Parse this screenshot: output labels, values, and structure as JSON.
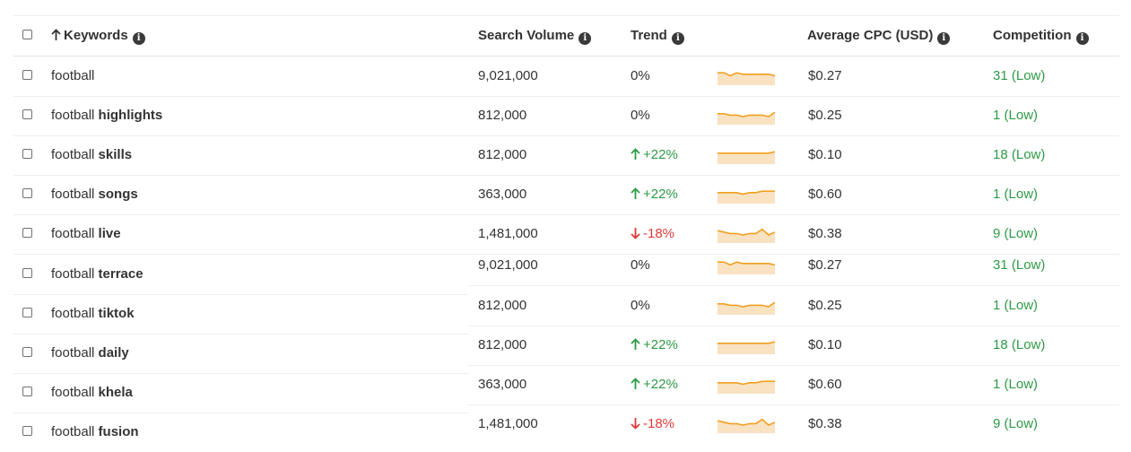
{
  "header": {
    "keywords": "Keywords",
    "search_volume": "Search Volume",
    "trend": "Trend",
    "cpc": "Average CPC (USD)",
    "competition": "Competition",
    "info_glyph": "i"
  },
  "rows_left": [
    {
      "prefix": "football",
      "bold": ""
    },
    {
      "prefix": "football",
      "bold": "highlights"
    },
    {
      "prefix": "football",
      "bold": "skills"
    },
    {
      "prefix": "football",
      "bold": "songs"
    },
    {
      "prefix": "football",
      "bold": "live"
    },
    {
      "prefix": "football",
      "bold": "terrace"
    },
    {
      "prefix": "football",
      "bold": "tiktok"
    },
    {
      "prefix": "football",
      "bold": "daily"
    },
    {
      "prefix": "football",
      "bold": "khela"
    },
    {
      "prefix": "football",
      "bold": "fusion"
    }
  ],
  "rows_data": [
    {
      "volume": "9,021,000",
      "trend": "0%",
      "dir": "flat",
      "cpc": "$0.27",
      "competition": "31 (Low)",
      "spark": [
        2,
        2,
        4,
        2,
        3,
        3,
        3,
        3,
        3,
        4
      ]
    },
    {
      "volume": "812,000",
      "trend": "0%",
      "dir": "flat",
      "cpc": "$0.25",
      "competition": "1 (Low)",
      "spark": [
        3,
        3,
        4,
        4,
        5,
        4,
        4,
        4,
        5,
        2
      ]
    },
    {
      "volume": "812,000",
      "trend": "+22%",
      "dir": "up",
      "cpc": "$0.10",
      "competition": "18 (Low)",
      "spark": [
        3,
        3,
        3,
        3,
        3,
        3,
        3,
        3,
        3,
        2
      ]
    },
    {
      "volume": "363,000",
      "trend": "+22%",
      "dir": "up",
      "cpc": "$0.60",
      "competition": "1 (Low)",
      "spark": [
        3,
        3,
        3,
        3,
        4,
        3,
        3,
        2,
        2,
        2
      ]
    },
    {
      "volume": "1,481,000",
      "trend": "-18%",
      "dir": "down",
      "cpc": "$0.38",
      "competition": "9 (Low)",
      "spark": [
        2,
        3,
        4,
        4,
        5,
        4,
        4,
        1,
        5,
        3
      ]
    }
  ],
  "rows_data_offset": [
    {
      "volume": "9,021,000",
      "trend": "0%",
      "dir": "flat",
      "cpc": "$0.27",
      "competition": "31 (Low)",
      "spark": [
        2,
        2,
        4,
        2,
        3,
        3,
        3,
        3,
        3,
        4
      ]
    },
    {
      "volume": "812,000",
      "trend": "0%",
      "dir": "flat",
      "cpc": "$0.25",
      "competition": "1 (Low)",
      "spark": [
        3,
        3,
        4,
        4,
        5,
        4,
        4,
        4,
        5,
        2
      ]
    },
    {
      "volume": "812,000",
      "trend": "+22%",
      "dir": "up",
      "cpc": "$0.10",
      "competition": "18 (Low)",
      "spark": [
        3,
        3,
        3,
        3,
        3,
        3,
        3,
        3,
        3,
        2
      ]
    },
    {
      "volume": "363,000",
      "trend": "+22%",
      "dir": "up",
      "cpc": "$0.60",
      "competition": "1 (Low)",
      "spark": [
        3,
        3,
        3,
        3,
        4,
        3,
        3,
        2,
        2,
        2
      ]
    },
    {
      "volume": "1,481,000",
      "trend": "-18%",
      "dir": "down",
      "cpc": "$0.38",
      "competition": "9 (Low)",
      "spark": [
        2,
        3,
        4,
        4,
        5,
        4,
        4,
        1,
        5,
        3
      ]
    }
  ],
  "colors": {
    "positive": "#2e9a46",
    "negative": "#e03a3a",
    "spark_line": "#f0a020",
    "spark_fill": "#f8e2c2"
  }
}
